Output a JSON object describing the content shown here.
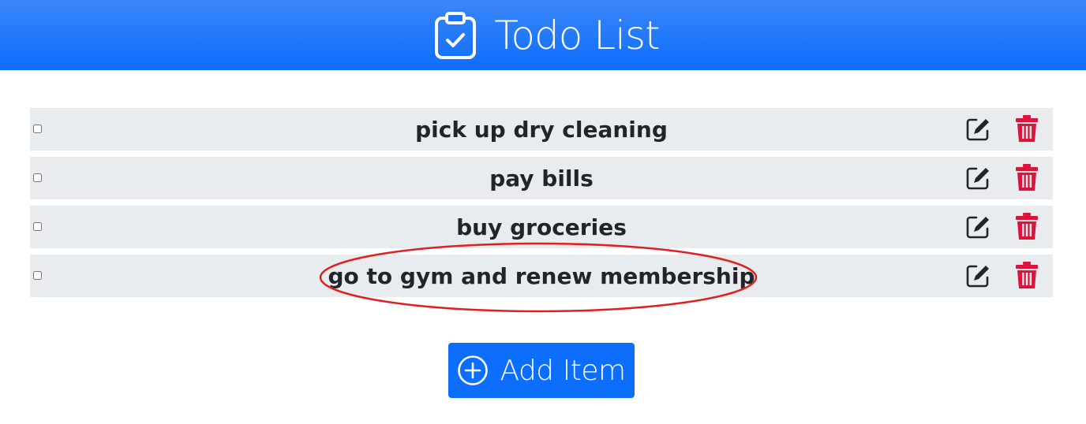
{
  "header": {
    "title": "Todo List",
    "icon": "clipboard-check-icon"
  },
  "todos": [
    {
      "label": "pick up dry cleaning",
      "checked": false
    },
    {
      "label": "pay bills",
      "checked": false
    },
    {
      "label": "buy groceries",
      "checked": false
    },
    {
      "label": "go to gym and renew membership",
      "checked": false
    }
  ],
  "row_actions": {
    "edit_icon": "pencil-square-icon",
    "delete_icon": "trash-icon"
  },
  "add_button": {
    "label": "Add Item",
    "icon": "plus-circle-icon"
  },
  "colors": {
    "header_bg": "#0d6efd",
    "row_bg": "#e9ecef",
    "delete": "#dc143c",
    "annotation": "#e02020"
  }
}
